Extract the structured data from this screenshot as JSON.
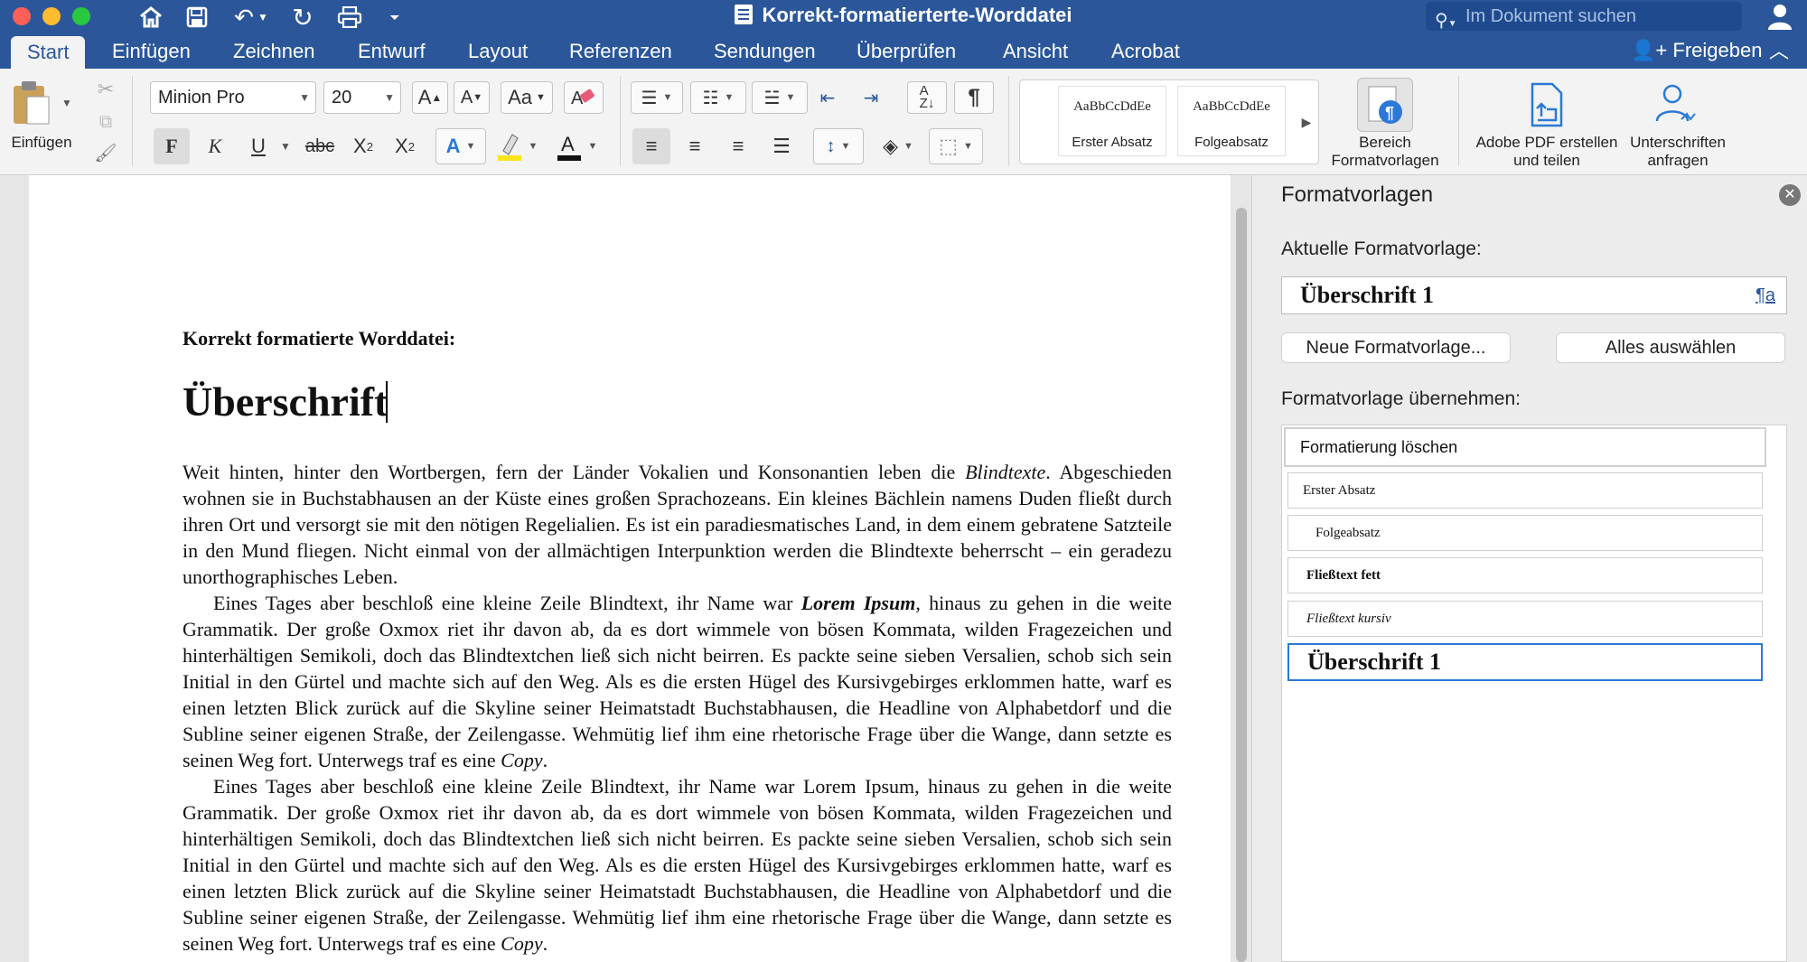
{
  "window": {
    "title": "Korrekt-formatierterte-Worddatei",
    "search_placeholder": "Im Dokument suchen"
  },
  "tabs": [
    {
      "label": "Start"
    },
    {
      "label": "Einfügen"
    },
    {
      "label": "Zeichnen"
    },
    {
      "label": "Entwurf"
    },
    {
      "label": "Layout"
    },
    {
      "label": "Referenzen"
    },
    {
      "label": "Sendungen"
    },
    {
      "label": "Überprüfen"
    },
    {
      "label": "Ansicht"
    },
    {
      "label": "Acrobat"
    }
  ],
  "share_label": "Freigeben",
  "ribbon": {
    "paste_label": "Einfügen",
    "font_name": "Minion Pro",
    "font_size": "20",
    "bold": "F",
    "italic": "K",
    "underline": "U",
    "strike": "abc",
    "styles": [
      {
        "preview": "AaBbCcDdEe",
        "name": "Erster Absatz"
      },
      {
        "preview": "AaBbCcDdEe",
        "name": "Folgeabsatz"
      }
    ],
    "styles_pane_label": "Bereich Formatvorlagen",
    "adobe_pdf_label": "Adobe PDF erstellen und teilen",
    "signatures_label": "Unterschriften anfragen"
  },
  "document": {
    "label": "Korrekt formatierte Worddatei:",
    "heading": "Überschrift",
    "paragraphs": [
      {
        "p1": "Weit hinten, hinter den Wortbergen, fern der Länder Vokalien und Konsonantien leben die ",
        "em": "Blindtexte",
        "p2": ". Abgeschieden wohnen sie in Buchstabhausen an der Küste eines großen Sprachozeans. Ein kleines Bächlein namens Duden fließt durch ihren Ort und versorgt sie mit den nötigen Regelialien. Es ist ein paradiesmatisches Land, in dem einem gebratene Satzteile in den Mund fliegen. Nicht einmal von der allmächtigen Interpunktion werden die Blindtexte beherrscht – ein geradezu unorthographisches Leben."
      },
      {
        "p1": "Eines Tages aber beschloß eine kleine Zeile Blindtext, ihr Name war ",
        "em": "Lorem Ipsum",
        "p2": ", hinaus zu gehen in die weite Grammatik. Der große Oxmox riet ihr davon ab, da es dort wimmele von bösen Kommata, wilden Fragezeichen und hinterhältigen Semikoli, doch das Blindtextchen ließ sich nicht beirren. Es packte seine sieben Versalien, schob sich sein Initial in den Gürtel und machte sich auf den Weg. Als es die ersten Hügel des Kursivgebirges erklommen hatte, warf es einen letzten Blick zurück auf die Skyline seiner Heimatstadt Buchstabhausen, die Headline von Alphabetdorf und die Subline seiner eigenen Straße, der Zeilengasse. Wehmütig lief ihm eine rhetorische Frage über die Wange, dann setzte es seinen Weg fort. Unterwegs traf es eine ",
        "em2": "Copy",
        "p3": "."
      },
      {
        "p1": "Eines Tages aber beschloß eine kleine Zeile Blindtext, ihr Name war Lorem Ipsum, hinaus zu gehen in die weite Grammatik. Der große Oxmox riet ihr davon ab, da es dort wimmele von bösen Kommata, wilden Fragezeichen und hinterhältigen Semikoli, doch das Blindtextchen ließ sich nicht beirren. Es packte seine sieben Versalien, schob sich sein Initial in den Gürtel und machte sich auf den Weg. Als es die ersten Hügel des Kursivgebirges erklommen hatte, warf es einen letzten Blick zurück auf die Skyline seiner Heimatstadt Buchstabhausen, die Headline von Alphabetdorf und die Subline seiner eigenen Straße, der Zeilengasse. Wehmütig lief ihm eine rhetorische Frage über die Wange, dann setzte es seinen Weg fort. Unterwegs traf es eine ",
        "em": "Copy",
        "p2": "."
      }
    ]
  },
  "pane": {
    "title": "Formatvorlagen",
    "current_label": "Aktuelle Formatvorlage:",
    "current_value": "Überschrift 1",
    "new_style_button": "Neue Formatvorlage...",
    "select_all_button": "Alles auswählen",
    "apply_label": "Formatvorlage übernehmen:",
    "styles": [
      {
        "name": "Formatierung löschen"
      },
      {
        "name": "Erster Absatz"
      },
      {
        "name": "Folgeabsatz"
      },
      {
        "name": "Fließtext fett"
      },
      {
        "name": "Fließtext kursiv"
      },
      {
        "name": "Überschrift 1"
      }
    ]
  },
  "colors": {
    "brand": "#2b579a",
    "traffic_red": "#fe5f57",
    "traffic_yellow": "#febc2e",
    "traffic_green": "#28c840"
  }
}
